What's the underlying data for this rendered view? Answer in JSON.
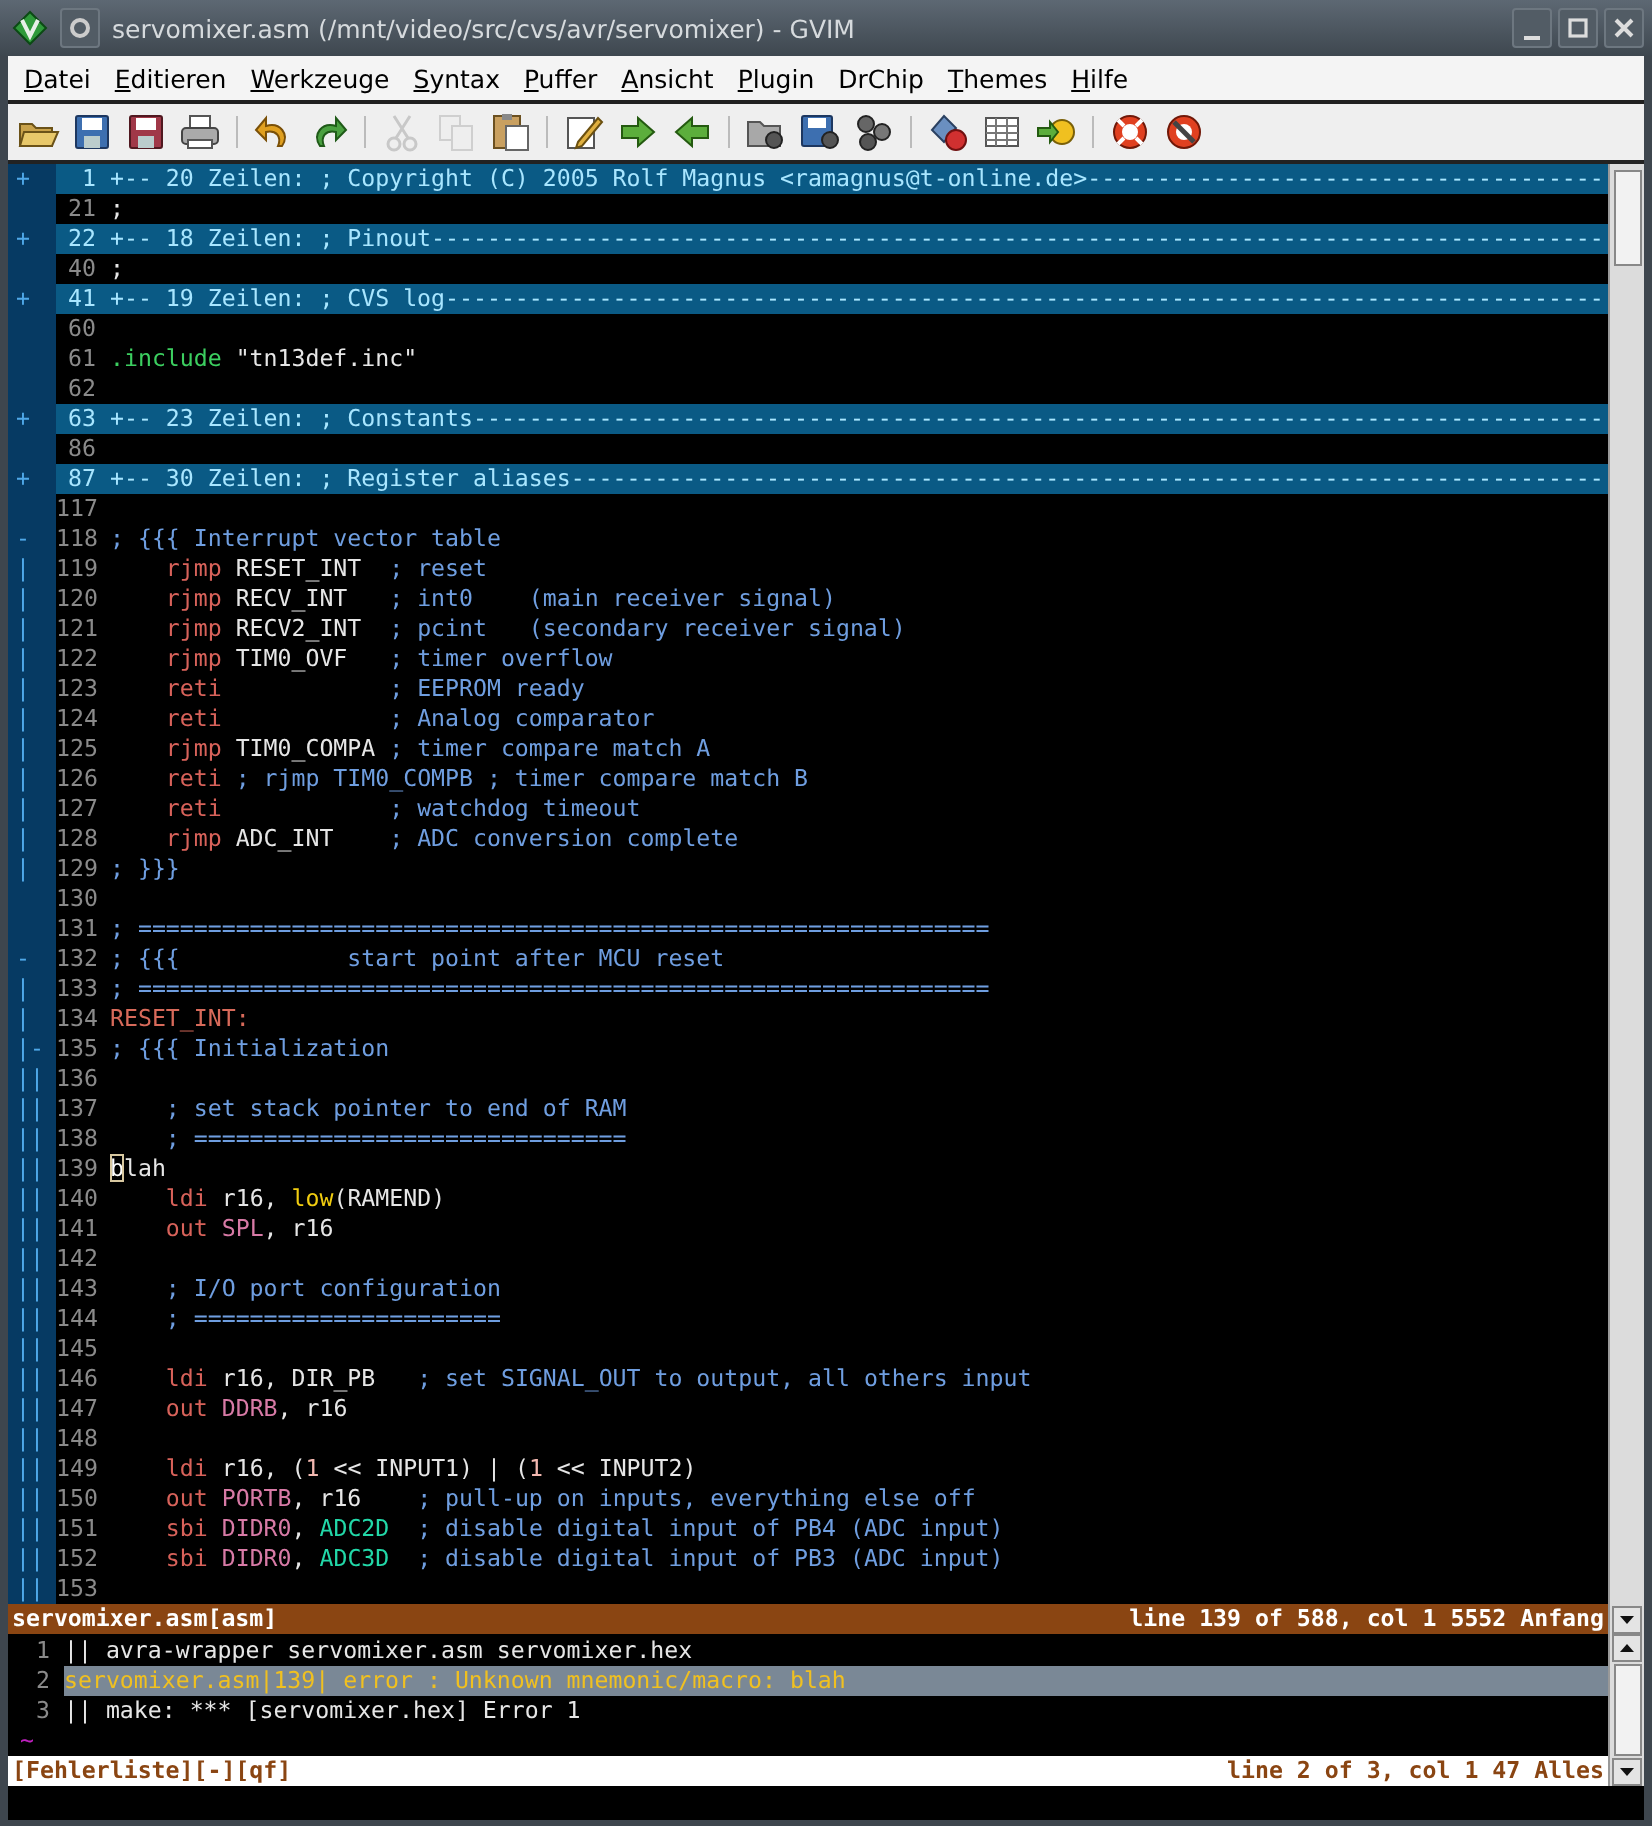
{
  "window": {
    "title": "servomixer.asm (/mnt/video/src/cvs/avr/servomixer) - GVIM"
  },
  "menu": [
    {
      "label": "Datei",
      "mnemonic": true
    },
    {
      "label": "Editieren",
      "mnemonic": true
    },
    {
      "label": "Werkzeuge",
      "mnemonic": true
    },
    {
      "label": "Syntax",
      "mnemonic": true
    },
    {
      "label": "Puffer",
      "mnemonic": true
    },
    {
      "label": "Ansicht",
      "mnemonic": true
    },
    {
      "label": "Plugin",
      "mnemonic": true
    },
    {
      "label": "DrChip",
      "mnemonic": false
    },
    {
      "label": "Themes",
      "mnemonic": true
    },
    {
      "label": "Hilfe",
      "mnemonic": true
    }
  ],
  "toolbar": [
    {
      "kind": "open",
      "disabled": false
    },
    {
      "kind": "save",
      "disabled": false
    },
    {
      "kind": "saveall",
      "disabled": false
    },
    {
      "kind": "print",
      "disabled": false
    },
    {
      "kind": "sep"
    },
    {
      "kind": "undo",
      "disabled": false
    },
    {
      "kind": "redo",
      "disabled": false
    },
    {
      "kind": "sep"
    },
    {
      "kind": "cut",
      "disabled": true
    },
    {
      "kind": "copy",
      "disabled": true
    },
    {
      "kind": "paste",
      "disabled": false
    },
    {
      "kind": "sep"
    },
    {
      "kind": "edit",
      "disabled": false
    },
    {
      "kind": "next",
      "disabled": false
    },
    {
      "kind": "prev",
      "disabled": false
    },
    {
      "kind": "sep"
    },
    {
      "kind": "loadsession",
      "disabled": false
    },
    {
      "kind": "savesession",
      "disabled": false
    },
    {
      "kind": "script",
      "disabled": false
    },
    {
      "kind": "sep"
    },
    {
      "kind": "make",
      "disabled": false
    },
    {
      "kind": "table",
      "disabled": false
    },
    {
      "kind": "jump",
      "disabled": false
    },
    {
      "kind": "sep"
    },
    {
      "kind": "help",
      "disabled": false
    },
    {
      "kind": "findhelp",
      "disabled": false
    }
  ],
  "editor": {
    "lines": [
      {
        "kind": "fold",
        "fold": "+",
        "num": "1",
        "text": "+-- 20 Zeilen: ; Copyright (C) 2005 Rolf Magnus <ramagnus@t-online.de>-------------------------------------"
      },
      {
        "kind": "code",
        "num": "21",
        "segs": [
          {
            "kind": "id",
            "text": ";"
          }
        ]
      },
      {
        "kind": "fold",
        "fold": "+",
        "num": "22",
        "text": "+-- 18 Zeilen: ; Pinout------------------------------------------------------------------------------------"
      },
      {
        "kind": "code",
        "num": "40",
        "segs": [
          {
            "kind": "id",
            "text": ";"
          }
        ]
      },
      {
        "kind": "fold",
        "fold": "+",
        "num": "41",
        "text": "+-- 19 Zeilen: ; CVS log-----------------------------------------------------------------------------------"
      },
      {
        "kind": "code",
        "num": "60"
      },
      {
        "kind": "code",
        "num": "61",
        "segs": [
          {
            "kind": "dir",
            "text": ".include"
          },
          {
            "kind": "str",
            "text": " \"tn13def.inc\""
          }
        ]
      },
      {
        "kind": "code",
        "num": "62"
      },
      {
        "kind": "fold",
        "fold": "+",
        "num": "63",
        "text": "+-- 23 Zeilen: ; Constants---------------------------------------------------------------------------------"
      },
      {
        "kind": "code",
        "num": "86"
      },
      {
        "kind": "fold",
        "fold": "+",
        "num": "87",
        "text": "+-- 30 Zeilen: ; Register aliases--------------------------------------------------------------------------"
      },
      {
        "kind": "code",
        "num": "117"
      },
      {
        "kind": "code",
        "fold": "-",
        "num": "118",
        "segs": [
          {
            "kind": "cm",
            "text": "; {{{ Interrupt vector table"
          }
        ]
      },
      {
        "kind": "code",
        "fold": "|",
        "num": "119",
        "segs": [
          {
            "kind": "kw",
            "text": "    rjmp"
          },
          {
            "kind": "id",
            "text": " RESET_INT  "
          },
          {
            "kind": "cm",
            "text": "; reset"
          }
        ]
      },
      {
        "kind": "code",
        "fold": "|",
        "num": "120",
        "segs": [
          {
            "kind": "kw",
            "text": "    rjmp"
          },
          {
            "kind": "id",
            "text": " RECV_INT   "
          },
          {
            "kind": "cm",
            "text": "; int0    (main receiver signal)"
          }
        ]
      },
      {
        "kind": "code",
        "fold": "|",
        "num": "121",
        "segs": [
          {
            "kind": "kw",
            "text": "    rjmp"
          },
          {
            "kind": "id",
            "text": " RECV2_INT  "
          },
          {
            "kind": "cm",
            "text": "; pcint   (secondary receiver signal)"
          }
        ]
      },
      {
        "kind": "code",
        "fold": "|",
        "num": "122",
        "segs": [
          {
            "kind": "kw",
            "text": "    rjmp"
          },
          {
            "kind": "id",
            "text": " TIM0_OVF   "
          },
          {
            "kind": "cm",
            "text": "; timer overflow"
          }
        ]
      },
      {
        "kind": "code",
        "fold": "|",
        "num": "123",
        "segs": [
          {
            "kind": "kw",
            "text": "    reti"
          },
          {
            "kind": "cm",
            "text": "            ; EEPROM ready"
          }
        ]
      },
      {
        "kind": "code",
        "fold": "|",
        "num": "124",
        "segs": [
          {
            "kind": "kw",
            "text": "    reti"
          },
          {
            "kind": "cm",
            "text": "            ; Analog comparator"
          }
        ]
      },
      {
        "kind": "code",
        "fold": "|",
        "num": "125",
        "segs": [
          {
            "kind": "kw",
            "text": "    rjmp"
          },
          {
            "kind": "id",
            "text": " TIM0_COMPA "
          },
          {
            "kind": "cm",
            "text": "; timer compare match A"
          }
        ]
      },
      {
        "kind": "code",
        "fold": "|",
        "num": "126",
        "segs": [
          {
            "kind": "kw",
            "text": "    reti"
          },
          {
            "kind": "cm",
            "text": " ; rjmp TIM0_COMPB ; timer compare match B"
          }
        ]
      },
      {
        "kind": "code",
        "fold": "|",
        "num": "127",
        "segs": [
          {
            "kind": "kw",
            "text": "    reti"
          },
          {
            "kind": "cm",
            "text": "            ; watchdog timeout"
          }
        ]
      },
      {
        "kind": "code",
        "fold": "|",
        "num": "128",
        "segs": [
          {
            "kind": "kw",
            "text": "    rjmp"
          },
          {
            "kind": "id",
            "text": " ADC_INT    "
          },
          {
            "kind": "cm",
            "text": "; ADC conversion complete"
          }
        ]
      },
      {
        "kind": "code",
        "fold": "|",
        "num": "129",
        "segs": [
          {
            "kind": "cm",
            "text": "; }}}"
          }
        ]
      },
      {
        "kind": "code",
        "num": "130"
      },
      {
        "kind": "code",
        "num": "131",
        "segs": [
          {
            "kind": "cm",
            "text": "; ============================================================="
          }
        ]
      },
      {
        "kind": "code",
        "fold": "-",
        "num": "132",
        "segs": [
          {
            "kind": "cm",
            "text": "; {{{            start point after MCU reset"
          }
        ]
      },
      {
        "kind": "code",
        "fold": "|",
        "num": "133",
        "segs": [
          {
            "kind": "cm",
            "text": "; ============================================================="
          }
        ]
      },
      {
        "kind": "code",
        "fold": "|",
        "num": "134",
        "segs": [
          {
            "kind": "label",
            "text": "RESET_INT:"
          }
        ]
      },
      {
        "kind": "code",
        "fold": "|-",
        "num": "135",
        "segs": [
          {
            "kind": "cm",
            "text": "; {{{ Initialization"
          }
        ]
      },
      {
        "kind": "code",
        "fold": "||",
        "num": "136"
      },
      {
        "kind": "code",
        "fold": "||",
        "num": "137",
        "segs": [
          {
            "kind": "cm",
            "text": "    ; set stack pointer to end of RAM"
          }
        ]
      },
      {
        "kind": "code",
        "fold": "||",
        "num": "138",
        "segs": [
          {
            "kind": "cm",
            "text": "    ; ==============================="
          }
        ]
      },
      {
        "kind": "code",
        "fold": "||",
        "num": "139",
        "segs": [
          {
            "kind": "cursor",
            "text": "b"
          },
          {
            "kind": "id",
            "text": "lah"
          }
        ]
      },
      {
        "kind": "code",
        "fold": "||",
        "num": "140",
        "segs": [
          {
            "kind": "kw",
            "text": "    ldi"
          },
          {
            "kind": "id",
            "text": " r16, "
          },
          {
            "kind": "fn",
            "text": "low"
          },
          {
            "kind": "id",
            "text": "(RAMEND)"
          }
        ]
      },
      {
        "kind": "code",
        "fold": "||",
        "num": "141",
        "segs": [
          {
            "kind": "kw",
            "text": "    out"
          },
          {
            "kind": "io",
            "text": " SPL"
          },
          {
            "kind": "id",
            "text": ", r16"
          }
        ]
      },
      {
        "kind": "code",
        "fold": "||",
        "num": "142"
      },
      {
        "kind": "code",
        "fold": "||",
        "num": "143",
        "segs": [
          {
            "kind": "cm",
            "text": "    ; I/O port configuration"
          }
        ]
      },
      {
        "kind": "code",
        "fold": "||",
        "num": "144",
        "segs": [
          {
            "kind": "cm",
            "text": "    ; ======================"
          }
        ]
      },
      {
        "kind": "code",
        "fold": "||",
        "num": "145"
      },
      {
        "kind": "code",
        "fold": "||",
        "num": "146",
        "segs": [
          {
            "kind": "kw",
            "text": "    ldi"
          },
          {
            "kind": "id",
            "text": " r16, DIR_PB   "
          },
          {
            "kind": "cm",
            "text": "; set SIGNAL_OUT to output, all others input"
          }
        ]
      },
      {
        "kind": "code",
        "fold": "||",
        "num": "147",
        "segs": [
          {
            "kind": "kw",
            "text": "    out"
          },
          {
            "kind": "io",
            "text": " DDRB"
          },
          {
            "kind": "id",
            "text": ", r16"
          }
        ]
      },
      {
        "kind": "code",
        "fold": "||",
        "num": "148"
      },
      {
        "kind": "code",
        "fold": "||",
        "num": "149",
        "segs": [
          {
            "kind": "kw",
            "text": "    ldi"
          },
          {
            "kind": "id",
            "text": " r16, ("
          },
          {
            "kind": "num",
            "text": "1"
          },
          {
            "kind": "id",
            "text": " << INPUT1) | ("
          },
          {
            "kind": "num",
            "text": "1"
          },
          {
            "kind": "id",
            "text": " << INPUT2)"
          }
        ]
      },
      {
        "kind": "code",
        "fold": "||",
        "num": "150",
        "segs": [
          {
            "kind": "kw",
            "text": "    out"
          },
          {
            "kind": "io",
            "text": " PORTB"
          },
          {
            "kind": "id",
            "text": ", r16    "
          },
          {
            "kind": "cm",
            "text": "; pull-up on inputs, everything else off"
          }
        ]
      },
      {
        "kind": "code",
        "fold": "||",
        "num": "151",
        "segs": [
          {
            "kind": "kw",
            "text": "    sbi"
          },
          {
            "kind": "io",
            "text": " DIDR0"
          },
          {
            "kind": "id",
            "text": ", "
          },
          {
            "kind": "const",
            "text": "ADC2D"
          },
          {
            "kind": "cm",
            "text": "  ; disable digital input of PB4 (ADC input)"
          }
        ]
      },
      {
        "kind": "code",
        "fold": "||",
        "num": "152",
        "segs": [
          {
            "kind": "kw",
            "text": "    sbi"
          },
          {
            "kind": "io",
            "text": " DIDR0"
          },
          {
            "kind": "id",
            "text": ", "
          },
          {
            "kind": "const",
            "text": "ADC3D"
          },
          {
            "kind": "cm",
            "text": "  ; disable digital input of PB3 (ADC input)"
          }
        ]
      },
      {
        "kind": "code",
        "fold": "||",
        "num": "153"
      }
    ],
    "status": {
      "active": true,
      "left": "servomixer.asm[asm]",
      "right": "line 139 of 588, col 1 5552 Anfang"
    }
  },
  "quickfix": {
    "lines": [
      {
        "num": "1",
        "text": "|| avra-wrapper servomixer.asm servomixer.hex",
        "selected": false
      },
      {
        "num": "2",
        "text": "servomixer.asm|139| error : Unknown mnemonic/macro: blah",
        "selected": true
      },
      {
        "num": "3",
        "text": "|| make: *** [servomixer.hex] Error 1",
        "selected": false
      }
    ],
    "filler": "~",
    "status": {
      "active": false,
      "left": "[Fehlerliste][-][qf]",
      "right": "line 2 of 3, col 1 47 Alles"
    }
  }
}
